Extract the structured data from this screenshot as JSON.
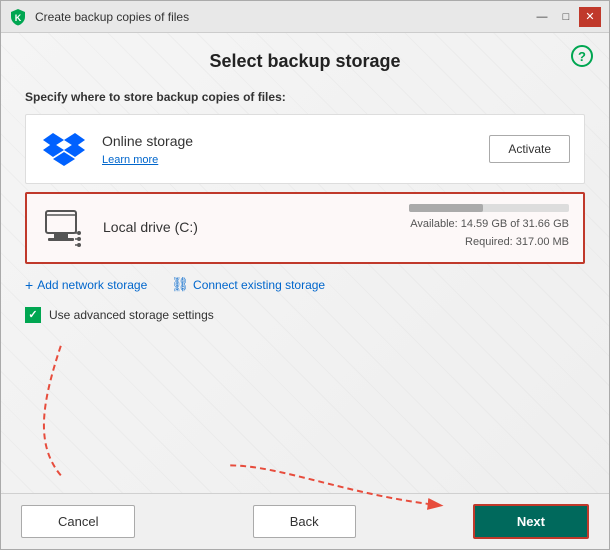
{
  "window": {
    "title": "Create backup copies of files",
    "icon": "shield"
  },
  "titlebar": {
    "minimize_label": "—",
    "maximize_label": "□",
    "close_label": "✕"
  },
  "help_icon": "?",
  "page": {
    "title": "Select backup storage",
    "subtitle": "Specify where to store backup copies of files:"
  },
  "storage_options": [
    {
      "id": "online",
      "name": "Online storage",
      "link_text": "Learn more",
      "selected": false,
      "action_label": "Activate"
    },
    {
      "id": "local",
      "name": "Local drive (C:)",
      "available_text": "Available: 14.59 GB of 31.66 GB",
      "required_text": "Required: 317.00 MB",
      "selected": true,
      "progress": 46
    }
  ],
  "links": [
    {
      "icon": "+",
      "label": "Add network storage"
    },
    {
      "icon": "🔗",
      "label": "Connect existing storage"
    }
  ],
  "checkbox": {
    "label": "Use advanced storage settings",
    "checked": true
  },
  "footer": {
    "cancel_label": "Cancel",
    "back_label": "Back",
    "next_label": "Next"
  }
}
